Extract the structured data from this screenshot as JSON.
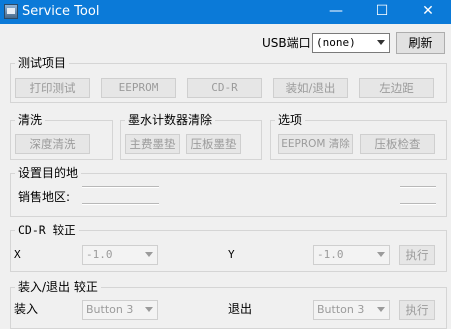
{
  "window": {
    "title": "Service Tool",
    "minimize": "—",
    "maximize": "☐",
    "close": "✕"
  },
  "usb": {
    "label": "USB端口",
    "selected": "(none)",
    "refresh": "刷新"
  },
  "test_items": {
    "title": "测试项目",
    "buttons": [
      "打印测试",
      "EEPROM",
      "CD-R",
      "装如/退出",
      "左边距"
    ]
  },
  "cleaning": {
    "title": "清洗",
    "deep_clean": "深度清洗"
  },
  "ink_counter": {
    "title": "墨水计数器清除",
    "main_pad": "主费墨垫",
    "platen_pad": "压板墨垫"
  },
  "options": {
    "title": "选项",
    "eeprom_clear": "EEPROM 清除",
    "platen_check": "压板检查"
  },
  "destination": {
    "title": "设置目的地",
    "region_label": "销售地区:"
  },
  "cdr_calibration": {
    "title": "CD-R 较正",
    "x_label": "X",
    "x_value": "-1.0",
    "y_label": "Y",
    "y_value": "-1.0",
    "execute": "执行"
  },
  "load_eject_calibration": {
    "title": "装入/退出 较正",
    "left_label": "装入",
    "left_value": "Button 3",
    "right_label": "退出",
    "right_value": "Button 3",
    "execute": "执行"
  }
}
